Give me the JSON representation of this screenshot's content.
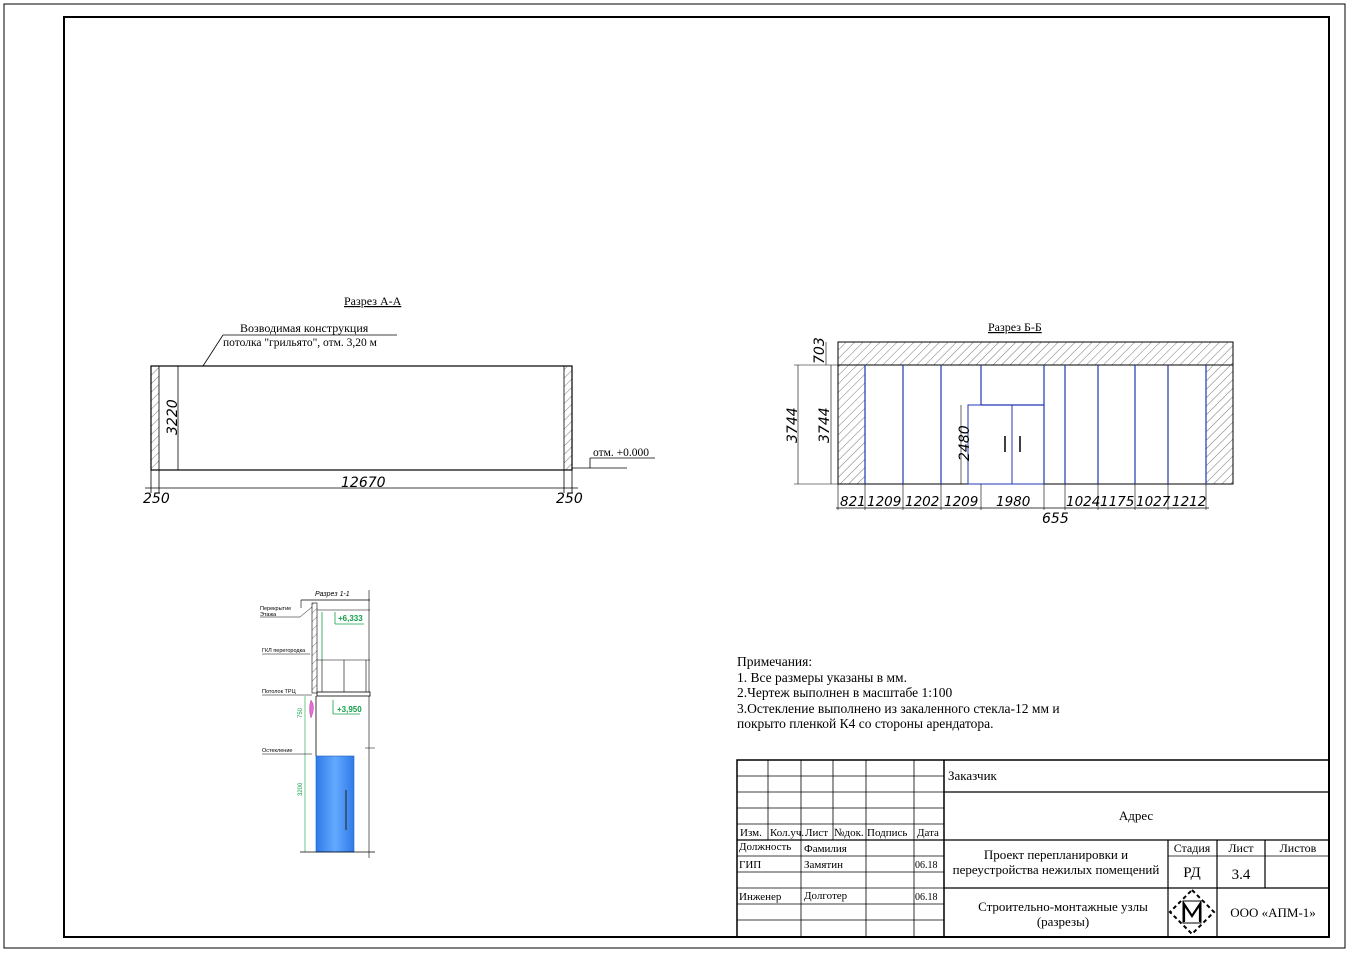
{
  "section_a": {
    "title": "Разрез А-А",
    "note_line1": "Возводимая конструкция",
    "note_line2": "потолка \"грильято\", отм. 3,20 м",
    "height": "3220",
    "length": "12670",
    "wall_left": "250",
    "wall_right": "250",
    "level": "отм. +0.000"
  },
  "section_b": {
    "title": "Разрез Б-Б",
    "top_dim": "703",
    "overall_height": "3744",
    "inner_height": "3744",
    "door_height": "2480",
    "bays": [
      "821",
      "1209",
      "1202",
      "1209",
      "1980",
      "1024",
      "1175",
      "1027",
      "1212"
    ],
    "total": "655"
  },
  "section_1": {
    "title": "Разрез 1-1",
    "label_slab": "Перекрытие",
    "label_floor": "Этажа",
    "label_gkl": "ГКЛ перегородка",
    "label_ceiling": "Потолок ТРЦ",
    "label_glazing": "Остекление",
    "level_top": "+6,333",
    "level_mid": "+3,950",
    "dim_upper": "750",
    "dim_lower": "3200"
  },
  "notes": {
    "heading": "Примечания:",
    "items": [
      "1. Все размеры указаны в мм.",
      "2.Чертеж выполнен в масштабе 1:100",
      "3.Остекление выполнено из закаленного стекла-12 мм и",
      "покрыто пленкой К4 со стороны арендатора."
    ]
  },
  "title_block": {
    "col_izm": "Изм.",
    "col_koluch": "Кол.уч.",
    "col_list": "Лист",
    "col_ndok": "№док.",
    "col_podpis": "Подпись",
    "col_data": "Дата",
    "hdr_position": "Должность",
    "hdr_surname": "Фамилия",
    "row1_position": "ГИП",
    "row1_surname": "Замятин",
    "row1_date": "06.18",
    "row2_position": "Инженер",
    "row2_surname": "Долготер",
    "row2_date": "06.18",
    "customer": "Заказчик",
    "address": "Адрес",
    "project_line1": "Проект перепланировки и",
    "project_line2": "переустройства нежилых помещений",
    "stage_label": "Стадия",
    "sheet_label": "Лист",
    "sheets_label": "Листов",
    "stage_value": "РД",
    "sheet_value": "3.4",
    "sheets_value": "",
    "drawing_line1": "Строительно-монтажные узлы",
    "drawing_line2": "(разрезы)",
    "company": "ООО «АПМ-1»"
  },
  "colors": {
    "blue_glass": "#1f37b5",
    "green_level": "#13a04a",
    "water_blue": "#3d8ff0"
  }
}
